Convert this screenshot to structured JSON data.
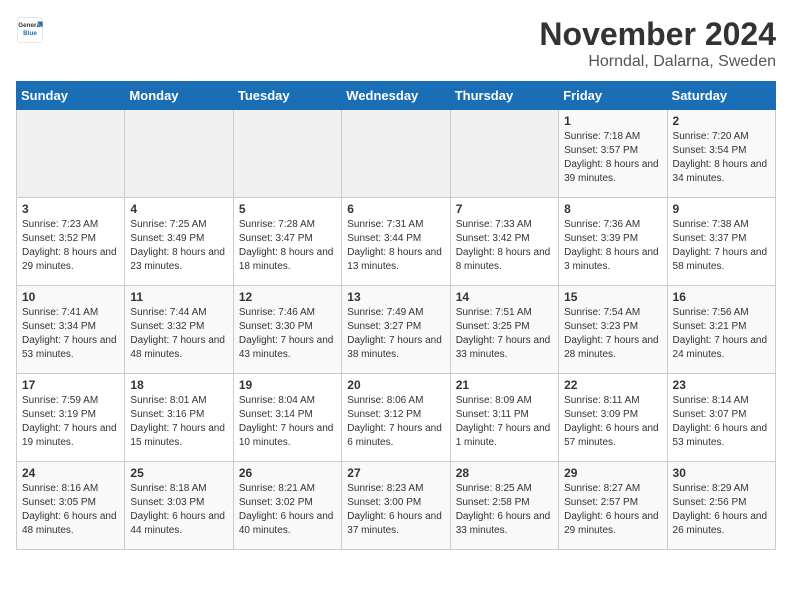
{
  "header": {
    "logo_general": "General",
    "logo_blue": "Blue",
    "month_title": "November 2024",
    "location": "Horndal, Dalarna, Sweden"
  },
  "weekdays": [
    "Sunday",
    "Monday",
    "Tuesday",
    "Wednesday",
    "Thursday",
    "Friday",
    "Saturday"
  ],
  "weeks": [
    [
      {
        "day": "",
        "info": ""
      },
      {
        "day": "",
        "info": ""
      },
      {
        "day": "",
        "info": ""
      },
      {
        "day": "",
        "info": ""
      },
      {
        "day": "",
        "info": ""
      },
      {
        "day": "1",
        "info": "Sunrise: 7:18 AM\nSunset: 3:57 PM\nDaylight: 8 hours and 39 minutes."
      },
      {
        "day": "2",
        "info": "Sunrise: 7:20 AM\nSunset: 3:54 PM\nDaylight: 8 hours and 34 minutes."
      }
    ],
    [
      {
        "day": "3",
        "info": "Sunrise: 7:23 AM\nSunset: 3:52 PM\nDaylight: 8 hours and 29 minutes."
      },
      {
        "day": "4",
        "info": "Sunrise: 7:25 AM\nSunset: 3:49 PM\nDaylight: 8 hours and 23 minutes."
      },
      {
        "day": "5",
        "info": "Sunrise: 7:28 AM\nSunset: 3:47 PM\nDaylight: 8 hours and 18 minutes."
      },
      {
        "day": "6",
        "info": "Sunrise: 7:31 AM\nSunset: 3:44 PM\nDaylight: 8 hours and 13 minutes."
      },
      {
        "day": "7",
        "info": "Sunrise: 7:33 AM\nSunset: 3:42 PM\nDaylight: 8 hours and 8 minutes."
      },
      {
        "day": "8",
        "info": "Sunrise: 7:36 AM\nSunset: 3:39 PM\nDaylight: 8 hours and 3 minutes."
      },
      {
        "day": "9",
        "info": "Sunrise: 7:38 AM\nSunset: 3:37 PM\nDaylight: 7 hours and 58 minutes."
      }
    ],
    [
      {
        "day": "10",
        "info": "Sunrise: 7:41 AM\nSunset: 3:34 PM\nDaylight: 7 hours and 53 minutes."
      },
      {
        "day": "11",
        "info": "Sunrise: 7:44 AM\nSunset: 3:32 PM\nDaylight: 7 hours and 48 minutes."
      },
      {
        "day": "12",
        "info": "Sunrise: 7:46 AM\nSunset: 3:30 PM\nDaylight: 7 hours and 43 minutes."
      },
      {
        "day": "13",
        "info": "Sunrise: 7:49 AM\nSunset: 3:27 PM\nDaylight: 7 hours and 38 minutes."
      },
      {
        "day": "14",
        "info": "Sunrise: 7:51 AM\nSunset: 3:25 PM\nDaylight: 7 hours and 33 minutes."
      },
      {
        "day": "15",
        "info": "Sunrise: 7:54 AM\nSunset: 3:23 PM\nDaylight: 7 hours and 28 minutes."
      },
      {
        "day": "16",
        "info": "Sunrise: 7:56 AM\nSunset: 3:21 PM\nDaylight: 7 hours and 24 minutes."
      }
    ],
    [
      {
        "day": "17",
        "info": "Sunrise: 7:59 AM\nSunset: 3:19 PM\nDaylight: 7 hours and 19 minutes."
      },
      {
        "day": "18",
        "info": "Sunrise: 8:01 AM\nSunset: 3:16 PM\nDaylight: 7 hours and 15 minutes."
      },
      {
        "day": "19",
        "info": "Sunrise: 8:04 AM\nSunset: 3:14 PM\nDaylight: 7 hours and 10 minutes."
      },
      {
        "day": "20",
        "info": "Sunrise: 8:06 AM\nSunset: 3:12 PM\nDaylight: 7 hours and 6 minutes."
      },
      {
        "day": "21",
        "info": "Sunrise: 8:09 AM\nSunset: 3:11 PM\nDaylight: 7 hours and 1 minute."
      },
      {
        "day": "22",
        "info": "Sunrise: 8:11 AM\nSunset: 3:09 PM\nDaylight: 6 hours and 57 minutes."
      },
      {
        "day": "23",
        "info": "Sunrise: 8:14 AM\nSunset: 3:07 PM\nDaylight: 6 hours and 53 minutes."
      }
    ],
    [
      {
        "day": "24",
        "info": "Sunrise: 8:16 AM\nSunset: 3:05 PM\nDaylight: 6 hours and 48 minutes."
      },
      {
        "day": "25",
        "info": "Sunrise: 8:18 AM\nSunset: 3:03 PM\nDaylight: 6 hours and 44 minutes."
      },
      {
        "day": "26",
        "info": "Sunrise: 8:21 AM\nSunset: 3:02 PM\nDaylight: 6 hours and 40 minutes."
      },
      {
        "day": "27",
        "info": "Sunrise: 8:23 AM\nSunset: 3:00 PM\nDaylight: 6 hours and 37 minutes."
      },
      {
        "day": "28",
        "info": "Sunrise: 8:25 AM\nSunset: 2:58 PM\nDaylight: 6 hours and 33 minutes."
      },
      {
        "day": "29",
        "info": "Sunrise: 8:27 AM\nSunset: 2:57 PM\nDaylight: 6 hours and 29 minutes."
      },
      {
        "day": "30",
        "info": "Sunrise: 8:29 AM\nSunset: 2:56 PM\nDaylight: 6 hours and 26 minutes."
      }
    ]
  ]
}
